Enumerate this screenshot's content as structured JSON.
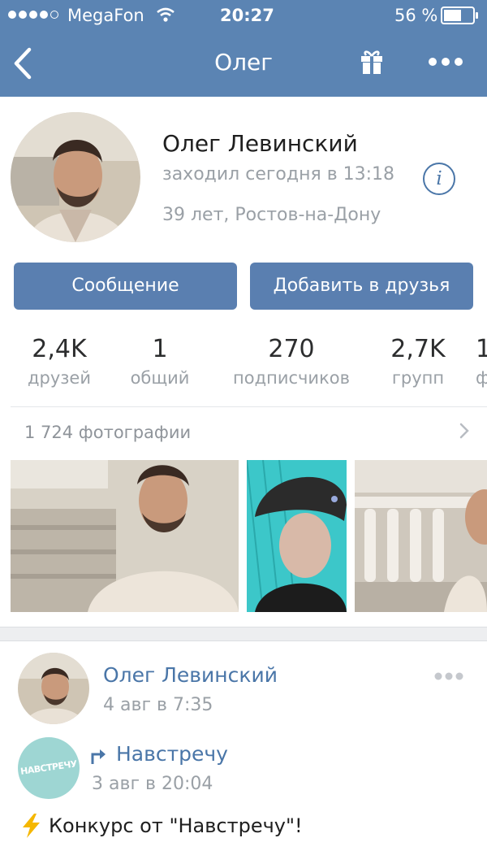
{
  "status_bar": {
    "carrier": "MegaFon",
    "time": "20:27",
    "battery": "56 %"
  },
  "nav": {
    "title": "Олег"
  },
  "profile": {
    "name": "Олег Левинский",
    "last_seen": "заходил сегодня в 13:18",
    "details": "39 лет, Ростов-на-Дону",
    "info_glyph": "i"
  },
  "actions": {
    "message_label": "Сообщение",
    "add_friend_label": "Добавить в друзья"
  },
  "counters": [
    {
      "value": "2,4K",
      "label": "друзей"
    },
    {
      "value": "1",
      "label": "общий"
    },
    {
      "value": "270",
      "label": "подписчиков"
    },
    {
      "value": "2,7K",
      "label": "групп"
    },
    {
      "value": "1",
      "label": "ф"
    }
  ],
  "photos": {
    "header": "1 724 фотографии"
  },
  "post": {
    "author": "Олег Левинский",
    "date": "4 авг в 7:35",
    "repost": {
      "logo_text": "НАВСТРЕЧУ",
      "source": "Навстречу",
      "date": "3 авг в 20:04"
    },
    "text": "Конкурс от \"Навстречу\"!"
  },
  "colors": {
    "header_bg": "#5b84b3",
    "button_bg": "#5a7fb0",
    "link": "#4a76a8",
    "muted": "#9aa0a6"
  },
  "icons": [
    "signal-dots-icon",
    "wifi-icon",
    "battery-icon",
    "back-chevron-icon",
    "gift-icon",
    "more-icon",
    "info-icon",
    "chevron-right-icon",
    "repost-arrow-icon",
    "lightning-icon"
  ]
}
